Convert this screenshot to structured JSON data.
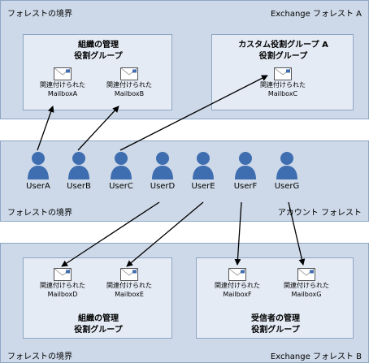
{
  "top_forest": {
    "boundary_label": "フォレストの境界",
    "forest_name": "Exchange フォレスト A",
    "group_mgmt": {
      "title_line1": "組織の管理",
      "title_line2": "役割グループ",
      "mailboxes": [
        {
          "label_line1": "関連付けられた",
          "label_line2": "MailboxA"
        },
        {
          "label_line1": "関連付けられた",
          "label_line2": "MailboxB"
        }
      ]
    },
    "group_custom": {
      "title_line1": "カスタム役割グループ A",
      "title_line2": "役割グループ",
      "mailboxes": [
        {
          "label_line1": "関連付けられた",
          "label_line2": "MailboxC"
        }
      ]
    }
  },
  "account_forest": {
    "users": [
      "UserA",
      "UserB",
      "UserC",
      "UserD",
      "UserE",
      "UserF",
      "UserG"
    ],
    "boundary_label": "フォレストの境界",
    "forest_name": "アカウント フォレスト"
  },
  "bottom_forest": {
    "boundary_label": "フォレストの境界",
    "forest_name": "Exchange フォレスト B",
    "group_mgmt": {
      "title_line1": "組織の管理",
      "title_line2": "役割グループ",
      "mailboxes": [
        {
          "label_line1": "関連付けられた",
          "label_line2": "MailboxD"
        },
        {
          "label_line1": "関連付けられた",
          "label_line2": "MailboxE"
        }
      ]
    },
    "group_recipient": {
      "title_line1": "受信者の管理",
      "title_line2": "役割グループ",
      "mailboxes": [
        {
          "label_line1": "関連付けられた",
          "label_line2": "MailboxF"
        },
        {
          "label_line1": "関連付けられた",
          "label_line2": "MailboxG"
        }
      ]
    }
  },
  "colors": {
    "band_fill": "#cdd9e8",
    "box_fill": "#e4ebf5",
    "border": "#8ea6c4",
    "user_icon": "#3f6eb0",
    "mail_icon_stamp": "#3f6eb0"
  },
  "icons": {
    "user": "user-icon",
    "mailbox": "mailbox-icon"
  }
}
